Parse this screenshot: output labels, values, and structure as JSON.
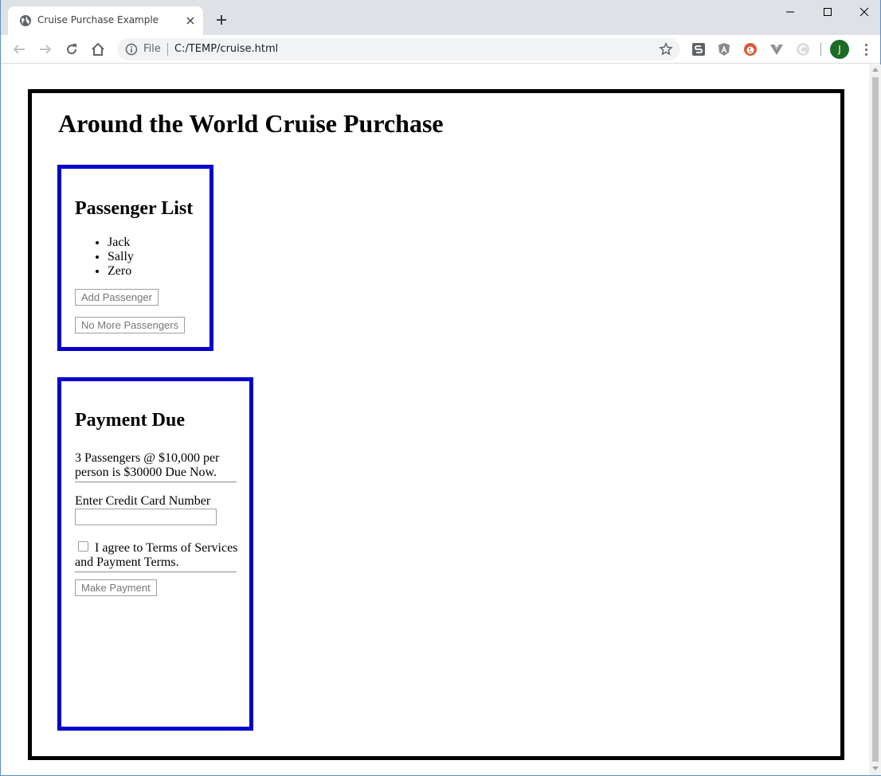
{
  "browser": {
    "tab_title": "Cruise Purchase Example",
    "omnibox_scheme": "File",
    "omnibox_url": "C:/TEMP/cruise.html",
    "profile_initial": "J"
  },
  "page": {
    "title": "Around the World Cruise Purchase",
    "passengers_panel": {
      "heading": "Passenger List",
      "passengers": [
        "Jack",
        "Sally",
        "Zero"
      ],
      "add_button": "Add Passenger",
      "done_button": "No More Passengers"
    },
    "payment_panel": {
      "heading": "Payment Due",
      "summary": "3 Passengers @ $10,000 per person is $30000 Due Now.",
      "cc_label": "Enter Credit Card Number",
      "cc_value": "",
      "terms_label": "I agree to Terms of Services and Payment Terms.",
      "terms_checked": false,
      "pay_button": "Make Payment"
    }
  },
  "colors": {
    "panel_border": "#0000cc",
    "frame_border": "#000000",
    "tab_strip": "#dee1e6"
  }
}
